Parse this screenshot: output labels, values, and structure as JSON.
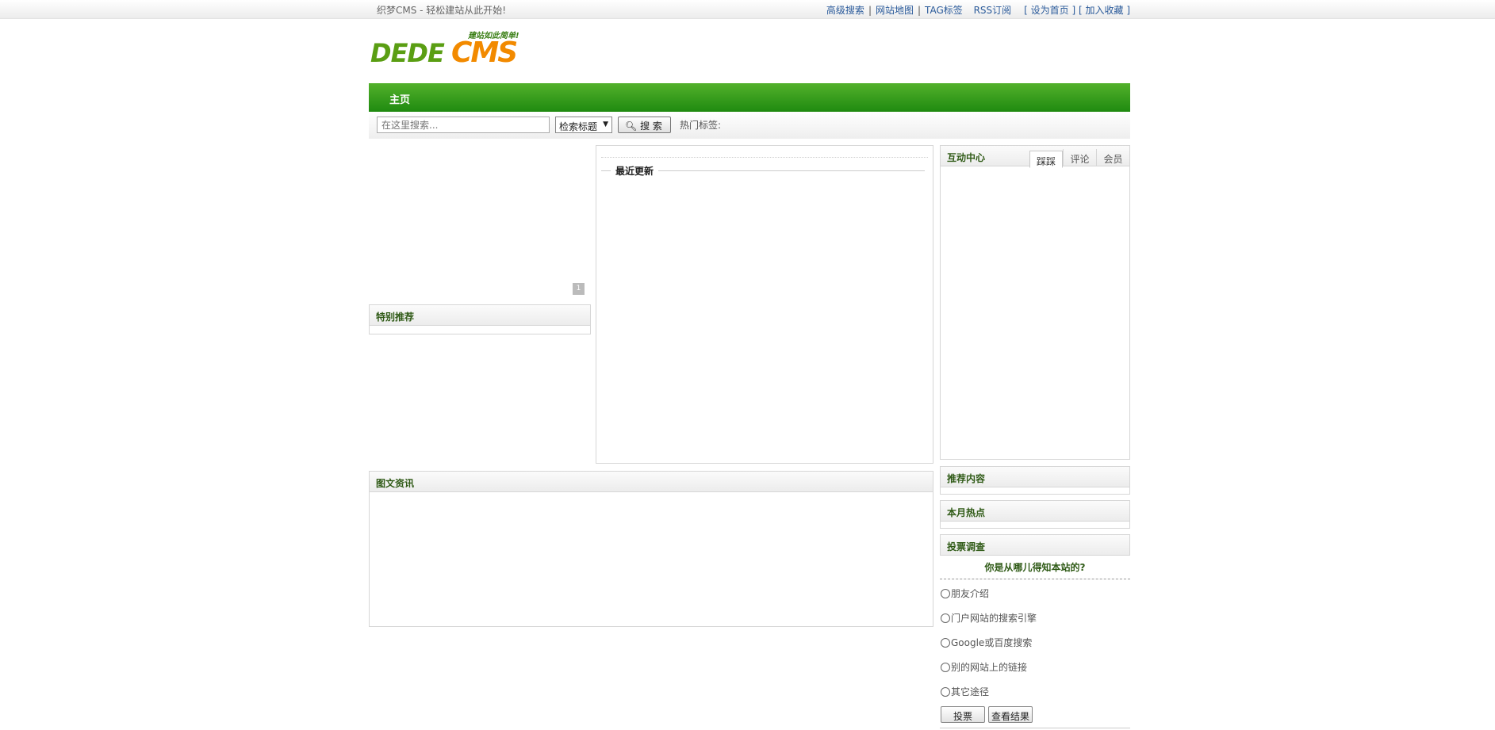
{
  "topbar": {
    "slogan": "织梦CMS - 轻松建站从此开始!",
    "links": [
      "高级搜索",
      "网站地图",
      "TAG标签",
      "RSS订阅"
    ],
    "sethome": "设为首页",
    "favorite": "加入收藏"
  },
  "logo": {
    "main_left": "DEDE",
    "main_right": "CMS",
    "tagline": "建站如此简单!"
  },
  "nav": {
    "home": "主页"
  },
  "search": {
    "placeholder": "在这里搜索...",
    "select_value": "检索标题",
    "button_label": "搜 索",
    "hot_label": "热门标签:"
  },
  "panels": {
    "special": "特别推荐",
    "latest": "最近更新",
    "interactive": "互动中心",
    "tabs": [
      "踩踩",
      "评论",
      "会员"
    ],
    "tuwen": "图文资讯",
    "recommend": "推荐内容",
    "hot_month": "本月热点",
    "vote": "投票调查"
  },
  "vote": {
    "question": "你是从哪儿得知本站的?",
    "options": [
      "朋友介绍",
      "门户网站的搜索引擎",
      "Google或百度搜索",
      "别的网站上的链接",
      "其它途径"
    ],
    "submit": "投票",
    "results": "查看结果"
  },
  "colors": {
    "nav_green": "#1f8a10",
    "heading_green": "#2f5a16",
    "link_blue": "#2a5a9a",
    "logo_orange": "#f28a00"
  }
}
